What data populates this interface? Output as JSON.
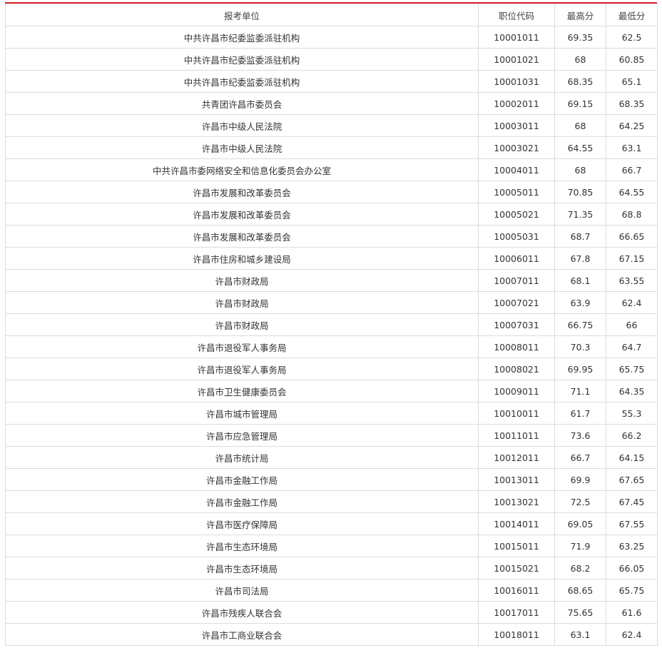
{
  "accent_color": "#d9262c",
  "table": {
    "headers": {
      "unit": "报考单位",
      "code": "职位代码",
      "max": "最高分",
      "min": "最低分"
    },
    "rows": [
      {
        "unit": "中共许昌市纪委监委派驻机构",
        "code": "10001011",
        "max": "69.35",
        "min": "62.5"
      },
      {
        "unit": "中共许昌市纪委监委派驻机构",
        "code": "10001021",
        "max": "68",
        "min": "60.85"
      },
      {
        "unit": "中共许昌市纪委监委派驻机构",
        "code": "10001031",
        "max": "68.35",
        "min": "65.1"
      },
      {
        "unit": "共青团许昌市委员会",
        "code": "10002011",
        "max": "69.15",
        "min": "68.35"
      },
      {
        "unit": "许昌市中级人民法院",
        "code": "10003011",
        "max": "68",
        "min": "64.25"
      },
      {
        "unit": "许昌市中级人民法院",
        "code": "10003021",
        "max": "64.55",
        "min": "63.1"
      },
      {
        "unit": "中共许昌市委网络安全和信息化委员会办公室",
        "code": "10004011",
        "max": "68",
        "min": "66.7"
      },
      {
        "unit": "许昌市发展和改革委员会",
        "code": "10005011",
        "max": "70.85",
        "min": "64.55"
      },
      {
        "unit": "许昌市发展和改革委员会",
        "code": "10005021",
        "max": "71.35",
        "min": "68.8"
      },
      {
        "unit": "许昌市发展和改革委员会",
        "code": "10005031",
        "max": "68.7",
        "min": "66.65"
      },
      {
        "unit": "许昌市住房和城乡建设局",
        "code": "10006011",
        "max": "67.8",
        "min": "67.15"
      },
      {
        "unit": "许昌市财政局",
        "code": "10007011",
        "max": "68.1",
        "min": "63.55"
      },
      {
        "unit": "许昌市财政局",
        "code": "10007021",
        "max": "63.9",
        "min": "62.4"
      },
      {
        "unit": "许昌市财政局",
        "code": "10007031",
        "max": "66.75",
        "min": "66"
      },
      {
        "unit": "许昌市退役军人事务局",
        "code": "10008011",
        "max": "70.3",
        "min": "64.7"
      },
      {
        "unit": "许昌市退役军人事务局",
        "code": "10008021",
        "max": "69.95",
        "min": "65.75"
      },
      {
        "unit": "许昌市卫生健康委员会",
        "code": "10009011",
        "max": "71.1",
        "min": "64.35"
      },
      {
        "unit": "许昌市城市管理局",
        "code": "10010011",
        "max": "61.7",
        "min": "55.3"
      },
      {
        "unit": "许昌市应急管理局",
        "code": "10011011",
        "max": "73.6",
        "min": "66.2"
      },
      {
        "unit": "许昌市统计局",
        "code": "10012011",
        "max": "66.7",
        "min": "64.15"
      },
      {
        "unit": "许昌市金融工作局",
        "code": "10013011",
        "max": "69.9",
        "min": "67.65"
      },
      {
        "unit": "许昌市金融工作局",
        "code": "10013021",
        "max": "72.5",
        "min": "67.45"
      },
      {
        "unit": "许昌市医疗保障局",
        "code": "10014011",
        "max": "69.05",
        "min": "67.55"
      },
      {
        "unit": "许昌市生态环境局",
        "code": "10015011",
        "max": "71.9",
        "min": "63.25"
      },
      {
        "unit": "许昌市生态环境局",
        "code": "10015021",
        "max": "68.2",
        "min": "66.05"
      },
      {
        "unit": "许昌市司法局",
        "code": "10016011",
        "max": "68.65",
        "min": "65.75"
      },
      {
        "unit": "许昌市残疾人联合会",
        "code": "10017011",
        "max": "75.65",
        "min": "61.6"
      },
      {
        "unit": "许昌市工商业联合会",
        "code": "10018011",
        "max": "63.1",
        "min": "62.4"
      }
    ]
  }
}
